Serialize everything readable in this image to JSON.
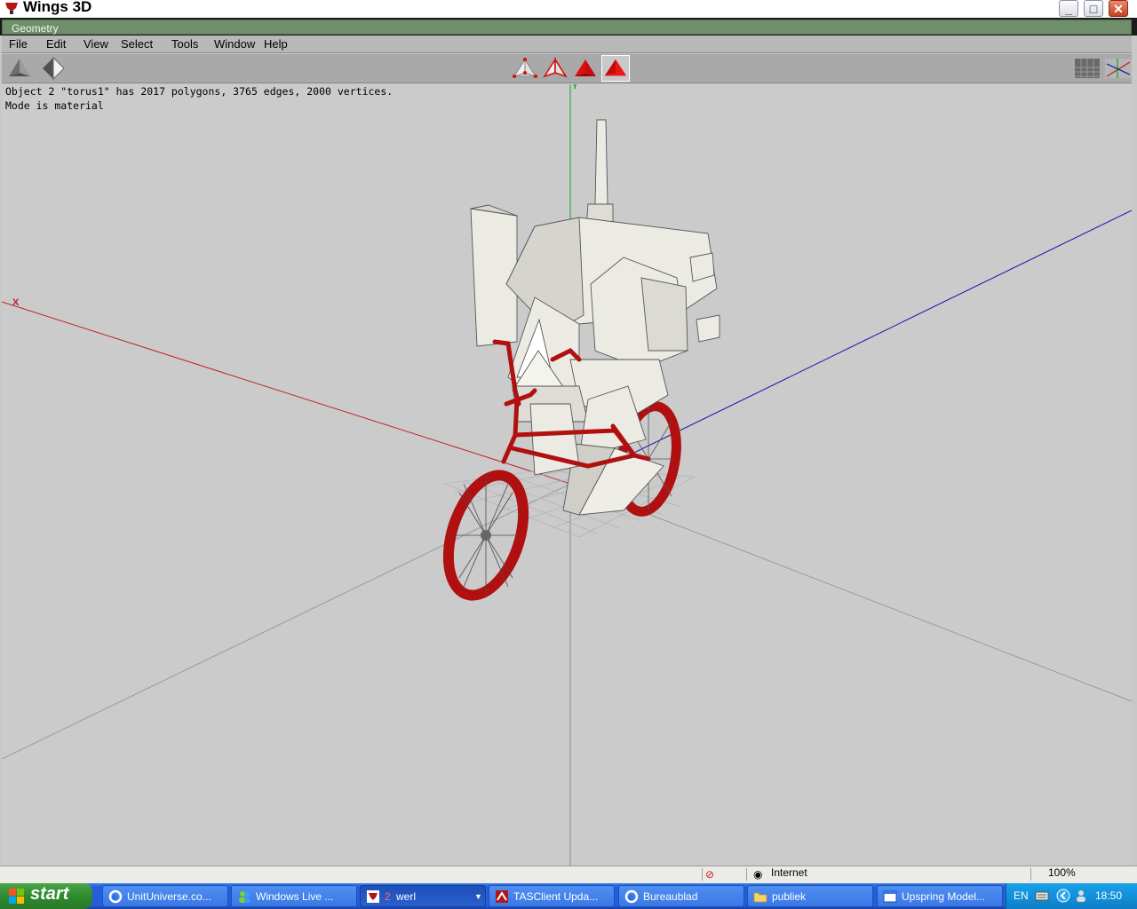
{
  "window": {
    "title": "Wings 3D"
  },
  "geometry_bar": {
    "label": "Geometry"
  },
  "menu": [
    {
      "label": "File"
    },
    {
      "label": "Edit"
    },
    {
      "label": "View"
    },
    {
      "label": "Select"
    },
    {
      "label": "Tools"
    },
    {
      "label": "Window"
    },
    {
      "label": "Help"
    }
  ],
  "toolbar": {
    "selected_mode": "face-mode"
  },
  "viewport": {
    "info_line1": "Object 2 \"torus1\" has 2017 polygons, 3765 edges, 2000 vertices.",
    "info_line2": "Mode is material",
    "axis_x_label": "X",
    "axis_y_label": "Y",
    "colors": {
      "x_axis": "#c02020",
      "y_axis": "#20a020",
      "z_axis": "#1010b0",
      "bike": "#b01010",
      "model": "#ecebe3"
    }
  },
  "status": {
    "zone": "Internet",
    "zoom": "100%"
  },
  "taskbar": {
    "start_label": "start",
    "tasks": [
      {
        "label": "UnitUniverse.co...",
        "icon": "ie-icon"
      },
      {
        "label": "Windows Live ...",
        "icon": "messenger-icon"
      },
      {
        "label": "werl",
        "count": "2",
        "icon": "erlang-icon"
      },
      {
        "label": "TASClient Upda...",
        "icon": "tasclient-icon"
      },
      {
        "label": "Bureaublad",
        "icon": "ie-icon"
      },
      {
        "label": "publiek",
        "icon": "folder-icon"
      },
      {
        "label": "Upspring Model...",
        "icon": "window-icon"
      }
    ],
    "tray": {
      "language": "EN",
      "time": "18:50"
    }
  }
}
